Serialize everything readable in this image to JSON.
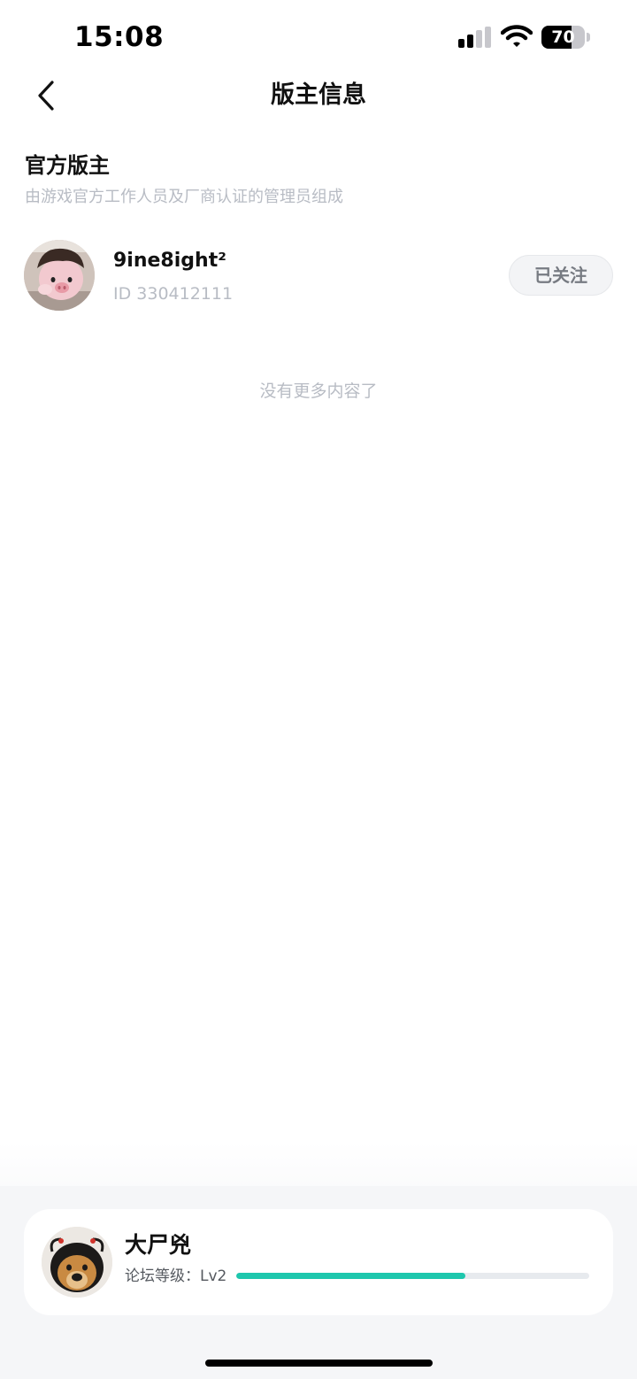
{
  "status_bar": {
    "time": "15:08",
    "battery_level": 70,
    "battery_text": "70",
    "signal_bars_active": 2,
    "signal_bars_total": 4
  },
  "nav": {
    "title": "版主信息",
    "back_icon": "chevron-left-icon"
  },
  "section": {
    "title": "官方版主",
    "subtitle": "由游戏官方工作人员及厂商认证的管理员组成"
  },
  "moderators": [
    {
      "name": "9ine8ight²",
      "id_text": "ID 330412111",
      "follow_label": "已关注"
    }
  ],
  "list_end_text": "没有更多内容了",
  "current_user": {
    "name": "大尸兇",
    "level_label": "论坛等级：Lv2",
    "level_progress": 0.65
  },
  "colors": {
    "accent": "#1ec7ad",
    "muted_text": "#b8bcc4",
    "card_bg": "#ffffff",
    "page_bottom_bg": "#f5f6f8"
  }
}
